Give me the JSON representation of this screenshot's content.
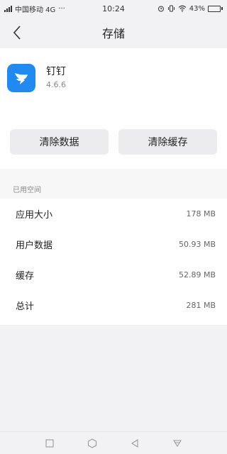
{
  "status_bar": {
    "carrier": "中国移动 4G",
    "dots": "···",
    "time": "10:24",
    "battery_percent": "43%",
    "battery_level": 0.43
  },
  "header": {
    "title": "存储"
  },
  "app": {
    "name": "钉钉",
    "version": "4.6.6"
  },
  "actions": {
    "clear_data": "清除数据",
    "clear_cache": "清除缓存"
  },
  "storage": {
    "section_title": "已用空间",
    "rows": [
      {
        "label": "应用大小",
        "value": "178 MB"
      },
      {
        "label": "用户数据",
        "value": "50.93 MB"
      },
      {
        "label": "缓存",
        "value": "52.89 MB"
      },
      {
        "label": "总计",
        "value": "281 MB"
      }
    ]
  },
  "colors": {
    "accent": "#1f8bf2",
    "background": "#f2f2f4",
    "button": "#ececee"
  },
  "icons": {
    "back": "chevron-left-icon",
    "app": "dingtalk-icon",
    "nav": [
      "square-icon",
      "hexagon-icon",
      "triangle-left-icon",
      "triangle-down-icon"
    ]
  }
}
